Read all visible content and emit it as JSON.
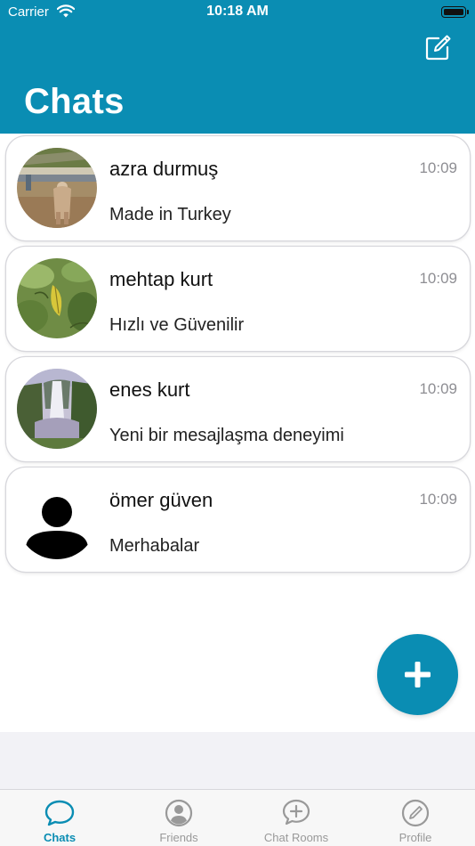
{
  "status_bar": {
    "carrier": "Carrier",
    "time": "10:18 AM"
  },
  "header": {
    "title": "Chats",
    "compose_icon": "compose-icon"
  },
  "chats": [
    {
      "name": "azra durmuş",
      "time": "10:09",
      "message": "Made in Turkey",
      "avatar": "photo-playground"
    },
    {
      "name": "mehtap kurt",
      "time": "10:09",
      "message": "Hızlı ve Güvenilir",
      "avatar": "photo-leaves"
    },
    {
      "name": "enes kurt",
      "time": "10:09",
      "message": "Yeni bir mesajlaşma deneyimi",
      "avatar": "photo-waterfall"
    },
    {
      "name": "ömer güven",
      "time": "10:09",
      "message": "Merhabalar",
      "avatar": "person-placeholder"
    }
  ],
  "fab": {
    "icon": "plus-icon"
  },
  "tabs": [
    {
      "label": "Chats",
      "icon": "chat-bubble-icon",
      "active": true
    },
    {
      "label": "Friends",
      "icon": "person-circle-icon",
      "active": false
    },
    {
      "label": "Chat Rooms",
      "icon": "add-chat-icon",
      "active": false
    },
    {
      "label": "Profile",
      "icon": "pencil-circle-icon",
      "active": false
    }
  ],
  "colors": {
    "accent": "#0a8db3",
    "inactive_tab": "#999999",
    "background": "#f2f2f6"
  }
}
